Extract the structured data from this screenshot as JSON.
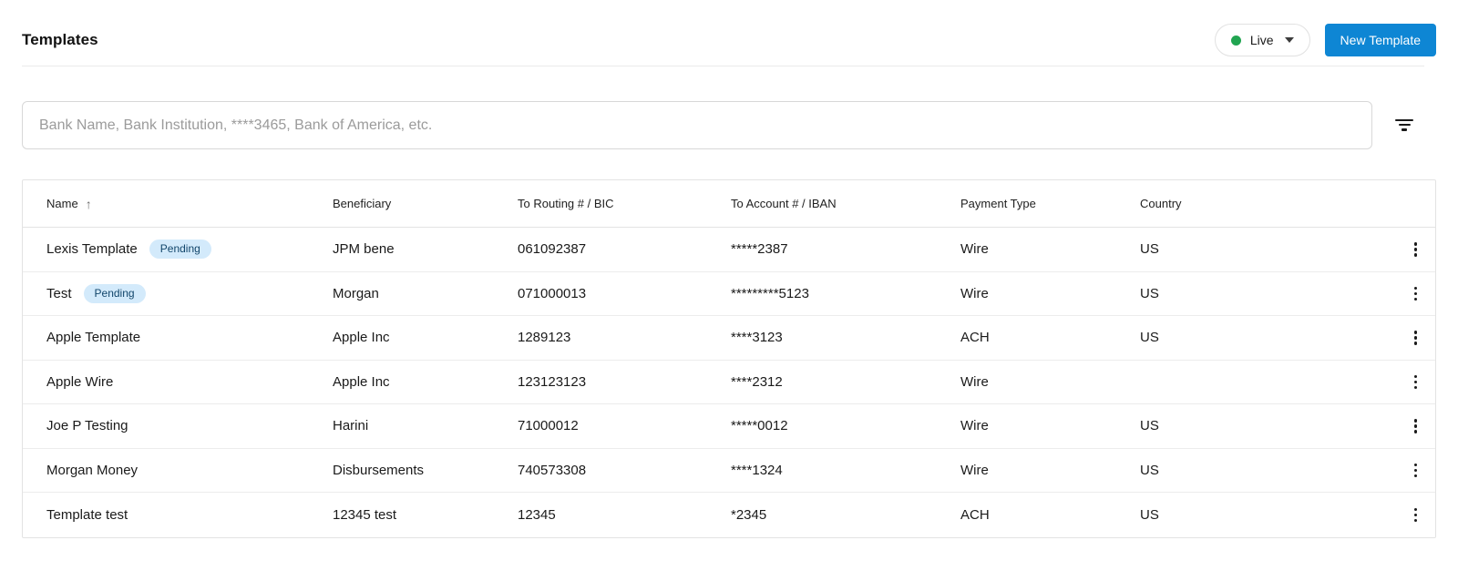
{
  "page": {
    "title": "Templates"
  },
  "header": {
    "environment": {
      "label": "Live"
    },
    "new_template_label": "New Template"
  },
  "search": {
    "placeholder": "Bank Name, Bank Institution, ****3465, Bank of America, etc."
  },
  "table": {
    "columns": [
      "Name",
      "Beneficiary",
      "To Routing # / BIC",
      "To Account # / IBAN",
      "Payment Type",
      "Country"
    ],
    "sort": {
      "column": "Name",
      "direction": "ascending",
      "arrow": "↑"
    },
    "rows": [
      {
        "name": "Lexis Template",
        "badge": "Pending",
        "beneficiary": "JPM bene",
        "routing": "061092387",
        "account": "*****2387",
        "payment_type": "Wire",
        "country": "US"
      },
      {
        "name": "Test",
        "badge": "Pending",
        "beneficiary": "Morgan",
        "routing": "071000013",
        "account": "*********5123",
        "payment_type": "Wire",
        "country": "US"
      },
      {
        "name": "Apple Template",
        "badge": "",
        "beneficiary": "Apple Inc",
        "routing": "1289123",
        "account": "****3123",
        "payment_type": "ACH",
        "country": "US"
      },
      {
        "name": "Apple Wire",
        "badge": "",
        "beneficiary": "Apple Inc",
        "routing": "123123123",
        "account": "****2312",
        "payment_type": "Wire",
        "country": ""
      },
      {
        "name": "Joe P Testing",
        "badge": "",
        "beneficiary": "Harini",
        "routing": "71000012",
        "account": "*****0012",
        "payment_type": "Wire",
        "country": "US"
      },
      {
        "name": "Morgan Money",
        "badge": "",
        "beneficiary": "Disbursements",
        "routing": "740573308",
        "account": "****1324",
        "payment_type": "Wire",
        "country": "US"
      },
      {
        "name": "Template test",
        "badge": "",
        "beneficiary": "12345 test",
        "routing": "12345",
        "account": "*2345",
        "payment_type": "ACH",
        "country": "US"
      }
    ]
  },
  "colors": {
    "accent_blue": "#0E86D4",
    "live_dot_green": "#21A551",
    "badge_bg": "#D3EAFB",
    "badge_text": "#12466B"
  }
}
